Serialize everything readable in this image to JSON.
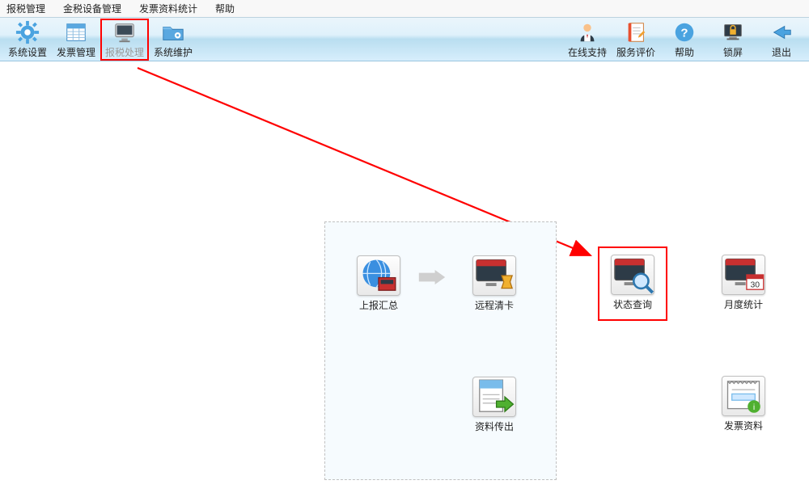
{
  "menubar": {
    "items": [
      "报税管理",
      "金税设备管理",
      "发票资料统计",
      "帮助"
    ]
  },
  "toolbar": {
    "left": [
      {
        "key": "system-settings",
        "label": "系统设置",
        "icon": "gear"
      },
      {
        "key": "invoice-mgmt",
        "label": "发票管理",
        "icon": "spreadsheet"
      },
      {
        "key": "tax-process",
        "label": "报税处理",
        "icon": "monitor",
        "highlighted": true
      },
      {
        "key": "system-maint",
        "label": "系统维护",
        "icon": "folder-gear"
      }
    ],
    "right": [
      {
        "key": "online-support",
        "label": "在线支持",
        "icon": "person"
      },
      {
        "key": "service-review",
        "label": "服务评价",
        "icon": "notebook"
      },
      {
        "key": "help",
        "label": "帮助",
        "icon": "help"
      },
      {
        "key": "lock",
        "label": "锁屏",
        "icon": "lock-screen"
      },
      {
        "key": "exit",
        "label": "退出",
        "icon": "back-arrow"
      }
    ]
  },
  "tiles": {
    "report_summary": "上报汇总",
    "remote_clear": "远程清卡",
    "export_data": "资料传出",
    "status_query": "状态查询",
    "monthly_stats": "月度统计",
    "invoice_data": "发票资料",
    "calendar_badge": "30"
  },
  "annotation": {
    "arrow_from": "toolbar.tax-process",
    "arrow_to": "tiles.status_query",
    "color": "#ff0000"
  }
}
